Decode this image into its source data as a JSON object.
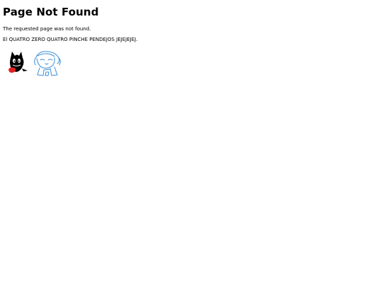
{
  "page": {
    "title": "Page Not Found",
    "message": "The requested page was not found.",
    "extra_message": "El QUATRO ZERO QUATRO PINCHE PENDEJOS JEJEJEJEJ."
  },
  "images": [
    {
      "icon": "cartoon-cat-icon",
      "color": "#000000",
      "accent": "#e02020"
    },
    {
      "icon": "cartoon-girl-sketch-icon",
      "color": "#3b8fd6"
    }
  ]
}
